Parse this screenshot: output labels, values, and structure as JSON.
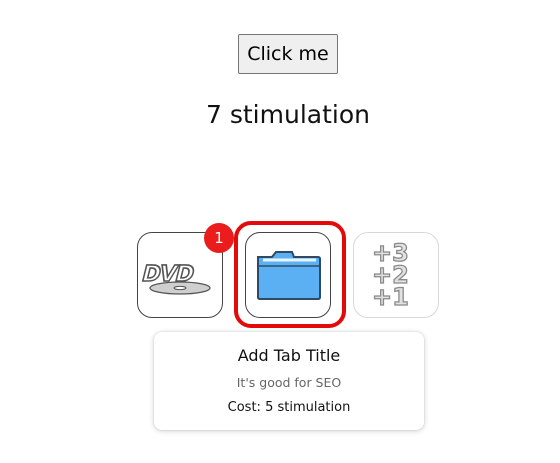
{
  "button": {
    "label": "Click me"
  },
  "counter": {
    "text": "7 stimulation"
  },
  "upgrades": [
    {
      "icon": "dvd-icon",
      "badge": "1"
    },
    {
      "icon": "folder-icon",
      "selected": true
    },
    {
      "icon": "plus-three-two-one-icon"
    }
  ],
  "tooltip": {
    "title": "Add Tab Title",
    "description": "It's good for SEO",
    "cost": "Cost: 5 stimulation"
  },
  "colors": {
    "highlight": "#e30a0a",
    "badge": "#ea1c1c",
    "folder": "#5ab0f2"
  }
}
